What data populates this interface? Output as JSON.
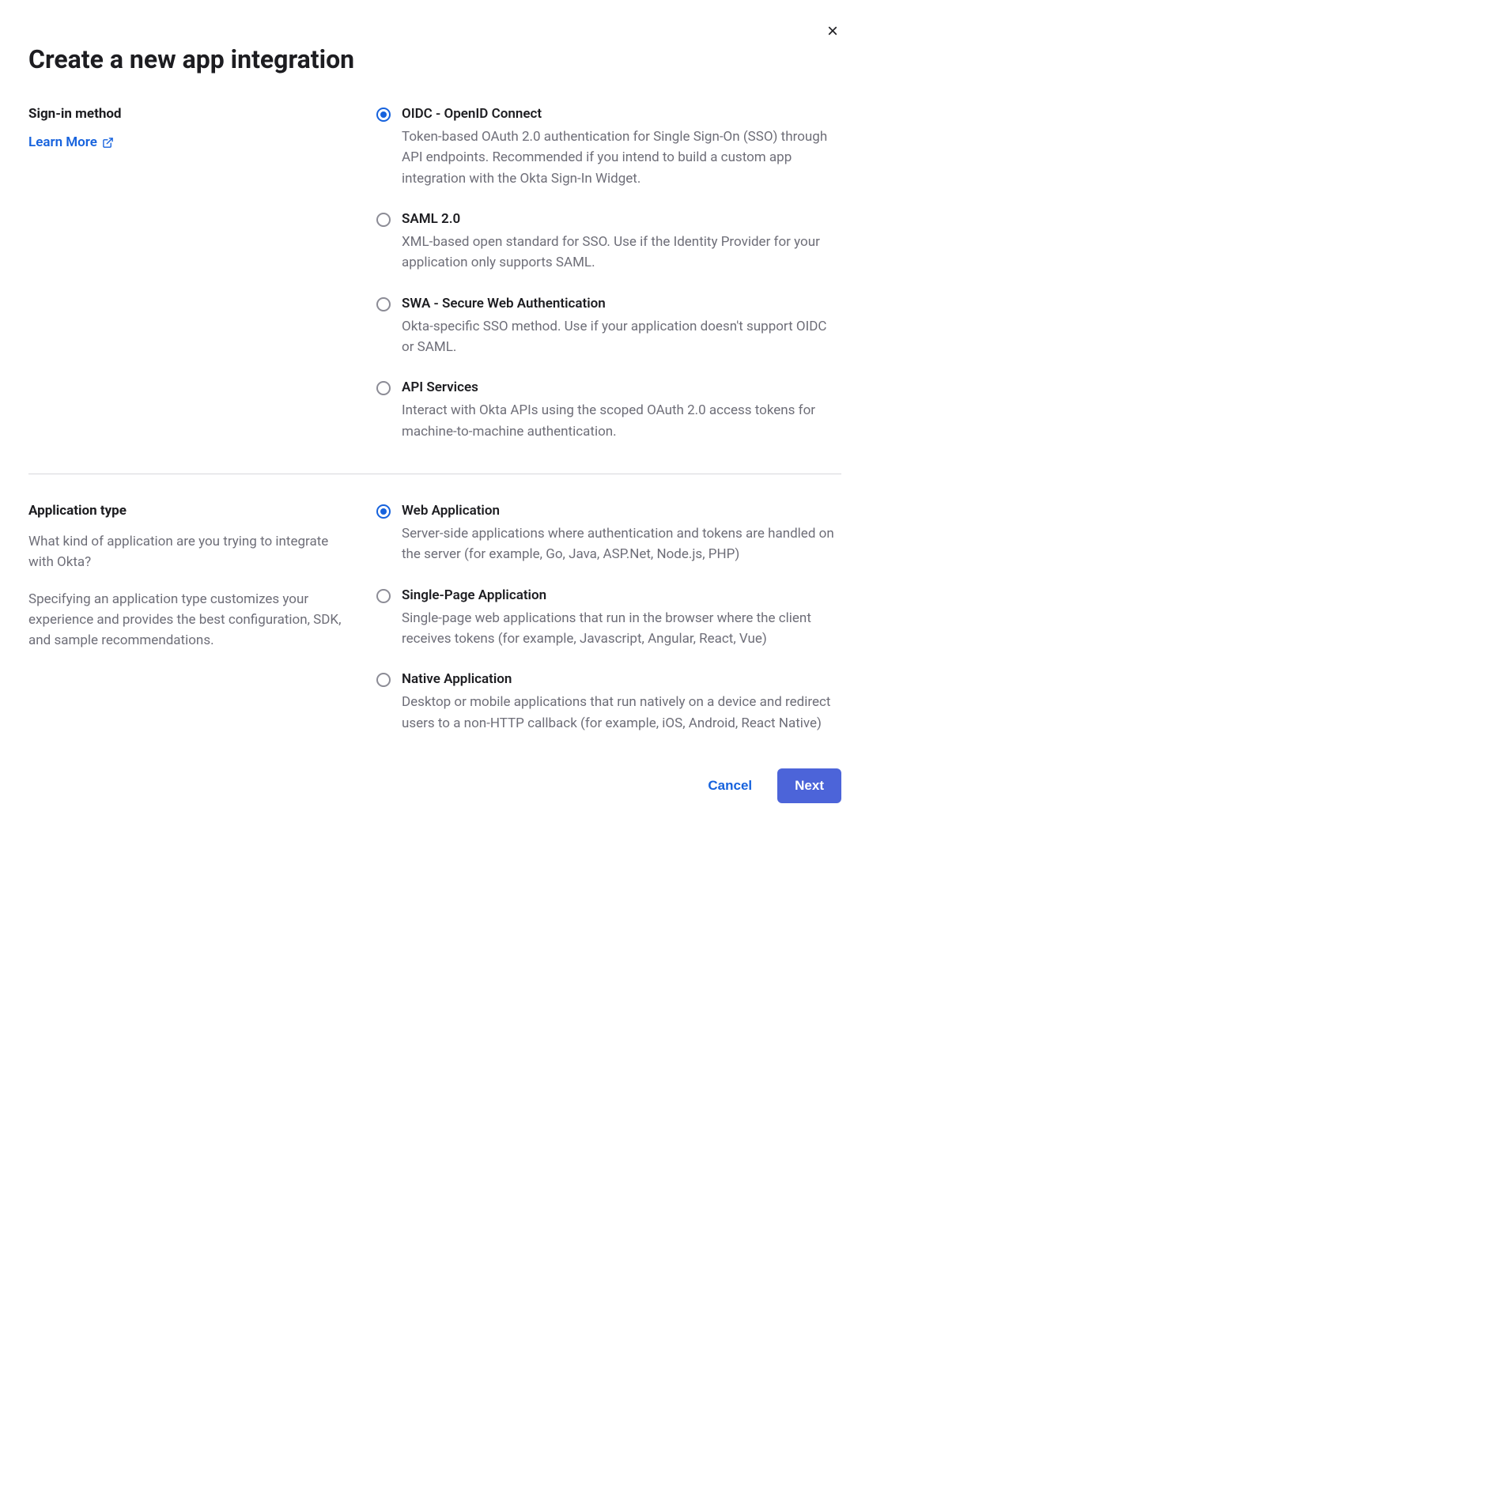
{
  "title": "Create a new app integration",
  "close_label": "×",
  "learn_more_label": "Learn More",
  "section_signin": {
    "heading": "Sign-in method",
    "options": [
      {
        "title": "OIDC - OpenID Connect",
        "desc": "Token-based OAuth 2.0 authentication for Single Sign-On (SSO) through API endpoints. Recommended if you intend to build a custom app integration with the Okta Sign-In Widget.",
        "selected": true
      },
      {
        "title": "SAML 2.0",
        "desc": "XML-based open standard for SSO. Use if the Identity Provider for your application only supports SAML.",
        "selected": false
      },
      {
        "title": "SWA - Secure Web Authentication",
        "desc": "Okta-specific SSO method. Use if your application doesn't support OIDC or SAML.",
        "selected": false
      },
      {
        "title": "API Services",
        "desc": "Interact with Okta APIs using the scoped OAuth 2.0 access tokens for machine-to-machine authentication.",
        "selected": false
      }
    ]
  },
  "section_apptype": {
    "heading": "Application type",
    "desc1": "What kind of application are you trying to integrate with Okta?",
    "desc2": "Specifying an application type customizes your experience and provides the best configuration, SDK, and sample recommendations.",
    "options": [
      {
        "title": "Web Application",
        "desc": "Server-side applications where authentication and tokens are handled on the server (for example, Go, Java, ASP.Net, Node.js, PHP)",
        "selected": true
      },
      {
        "title": "Single-Page Application",
        "desc": "Single-page web applications that run in the browser where the client receives tokens (for example, Javascript, Angular, React, Vue)",
        "selected": false
      },
      {
        "title": "Native Application",
        "desc": "Desktop or mobile applications that run natively on a device and redirect users to a non-HTTP callback (for example, iOS, Android, React Native)",
        "selected": false
      }
    ]
  },
  "footer": {
    "cancel": "Cancel",
    "next": "Next"
  }
}
